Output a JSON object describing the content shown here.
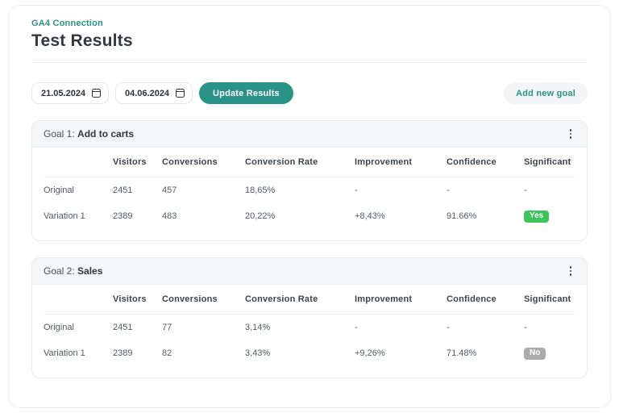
{
  "page": {
    "breadcrumb": "GA4 Connection",
    "title": "Test Results"
  },
  "controls": {
    "date_from": "21.05.2024",
    "date_to": "04.06.2024",
    "update_button": "Update Results",
    "add_goal_button": "Add new goal"
  },
  "icons": {
    "date_from": "calendar",
    "date_to": "calendar",
    "goal_menu": "kebab-vertical-dots"
  },
  "table_headers": {
    "label": "",
    "visitors": "Visitors",
    "conversions": "Conversions",
    "conversion_rate": "Conversion Rate",
    "improvement": "Improvement",
    "confidence": "Confidence",
    "significant": "Significant"
  },
  "goals": [
    {
      "label_prefix": "Goal 1: ",
      "name": "Add to carts",
      "rows": [
        {
          "label": "Original",
          "visitors": "2451",
          "conversions": "457",
          "conversion_rate": "18,65%",
          "improvement": "-",
          "confidence": "-",
          "significant": "-"
        },
        {
          "label": "Variation 1",
          "visitors": "2389",
          "conversions": "483",
          "conversion_rate": "20,22%",
          "improvement": "+8,43%",
          "confidence": "91.66%",
          "significant": "Yes"
        }
      ]
    },
    {
      "label_prefix": "Goal 2: ",
      "name": "Sales",
      "rows": [
        {
          "label": "Original",
          "visitors": "2451",
          "conversions": "77",
          "conversion_rate": "3,14%",
          "improvement": "-",
          "confidence": "-",
          "significant": "-"
        },
        {
          "label": "Variation 1",
          "visitors": "2389",
          "conversions": "82",
          "conversion_rate": "3,43%",
          "improvement": "+9,26%",
          "confidence": "71.48%",
          "significant": "No"
        }
      ]
    }
  ],
  "colors": {
    "accent": "#2a9286",
    "badge-yes": "#3cc35a",
    "badge-no": "#ababab",
    "title": "#34383d",
    "text": "#565b61",
    "head-text": "#3f444b",
    "band": "#f4f7f9",
    "card-border": "#e9edf0",
    "page-border": "#eceef1"
  }
}
